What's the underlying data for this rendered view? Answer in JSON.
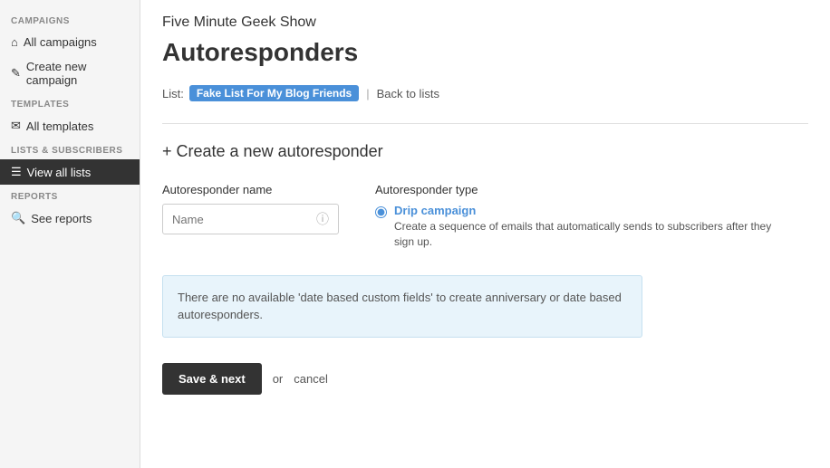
{
  "sidebar": {
    "campaigns_label": "CAMPAIGNS",
    "templates_label": "TEMPLATES",
    "lists_label": "LISTS & SUBSCRIBERS",
    "reports_label": "REPORTS",
    "items": {
      "all_campaigns": "All campaigns",
      "create_campaign": "Create new campaign",
      "all_templates": "All templates",
      "view_all_lists": "View all lists",
      "see_reports": "See reports"
    }
  },
  "header": {
    "org_title": "Five Minute Geek Show",
    "page_title": "Autoresponders"
  },
  "list_bar": {
    "label": "List:",
    "badge": "Fake List For My Blog Friends",
    "separator": "|",
    "back_link": "Back to lists"
  },
  "create_section": {
    "title": "+ Create a new autoresponder",
    "name_label": "Autoresponder name",
    "name_placeholder": "Name",
    "type_label": "Autoresponder type"
  },
  "radio_options": {
    "drip_label": "Drip campaign",
    "drip_description": "Create a sequence of emails that automatically sends to subscribers after they sign up."
  },
  "info_box": {
    "text": "There are no available 'date based custom fields' to create anniversary or date based autoresponders."
  },
  "actions": {
    "save_next": "Save & next",
    "or": "or",
    "cancel": "cancel"
  }
}
